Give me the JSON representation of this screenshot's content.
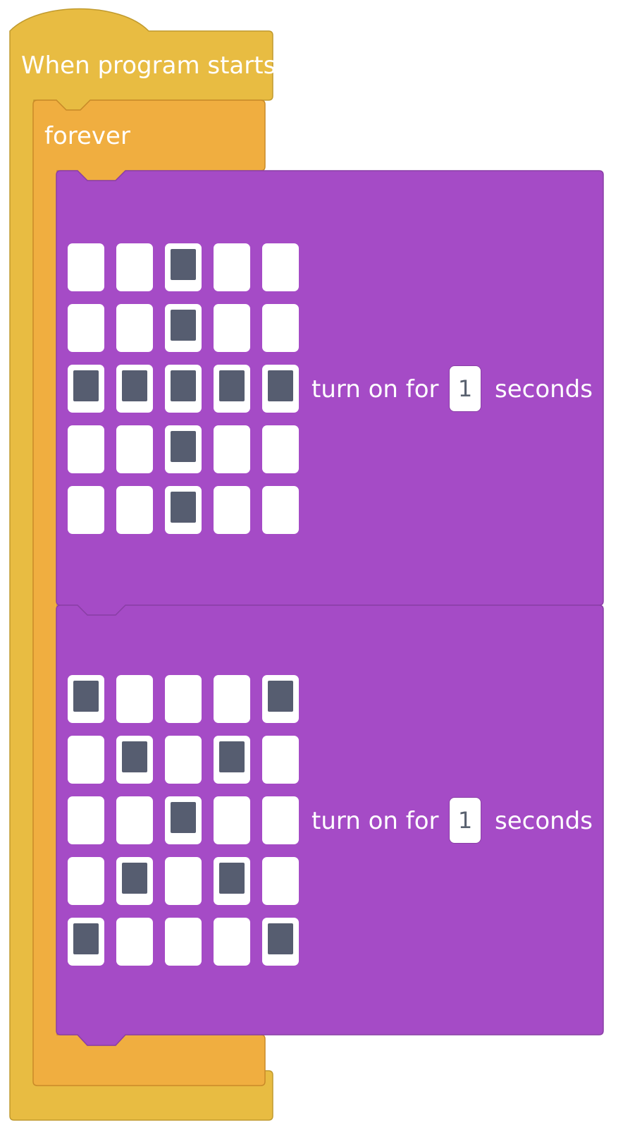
{
  "colors": {
    "hat_block": "#E8BC42",
    "forever_block": "#F0AE40",
    "led_block": "#A54BC6",
    "led_on": "#565D70",
    "led_off": "#FFFFFF"
  },
  "hat_block": {
    "label": "When program starts"
  },
  "forever_block": {
    "label": "forever"
  },
  "led_blocks": [
    {
      "prefix": "turn on for",
      "duration": "1",
      "suffix": "seconds",
      "pattern": [
        [
          0,
          0,
          1,
          0,
          0
        ],
        [
          0,
          0,
          1,
          0,
          0
        ],
        [
          1,
          1,
          1,
          1,
          1
        ],
        [
          0,
          0,
          1,
          0,
          0
        ],
        [
          0,
          0,
          1,
          0,
          0
        ]
      ]
    },
    {
      "prefix": "turn on for",
      "duration": "1",
      "suffix": "seconds",
      "pattern": [
        [
          1,
          0,
          0,
          0,
          1
        ],
        [
          0,
          1,
          0,
          1,
          0
        ],
        [
          0,
          0,
          1,
          0,
          0
        ],
        [
          0,
          1,
          0,
          1,
          0
        ],
        [
          1,
          0,
          0,
          0,
          1
        ]
      ]
    }
  ]
}
